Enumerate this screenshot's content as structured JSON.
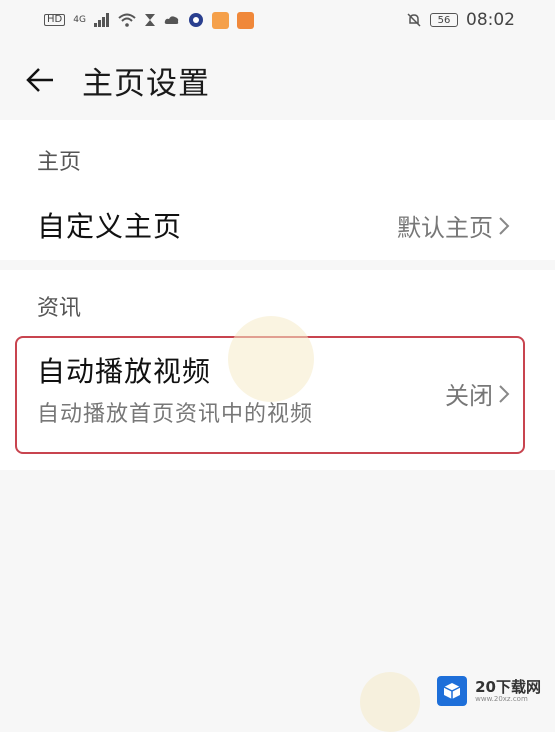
{
  "status_bar": {
    "hd_label": "HD",
    "network_label": "4G",
    "battery_label": "56",
    "time": "08:02"
  },
  "header": {
    "back_icon": "arrow-left-icon",
    "title": "主页设置"
  },
  "sections": [
    {
      "label": "主页",
      "rows": [
        {
          "title": "自定义主页",
          "value": "默认主页"
        }
      ]
    },
    {
      "label": "资讯",
      "rows": [
        {
          "title": "自动播放视频",
          "subtitle": "自动播放首页资讯中的视频",
          "value": "关闭"
        }
      ]
    }
  ],
  "watermark": {
    "brand": "20下载网",
    "site": "www.20xz.com"
  },
  "colors": {
    "highlight_border": "#c8444f",
    "background": "#f7f7f7",
    "card": "#ffffff"
  }
}
